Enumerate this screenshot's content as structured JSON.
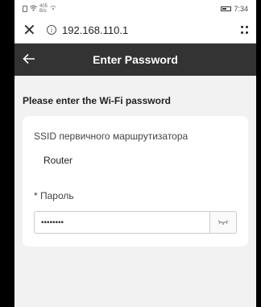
{
  "statusbar": {
    "net_speed_top": "405",
    "net_speed_bottom": "B/s",
    "time": "7:34"
  },
  "browser": {
    "url": "192.168.110.1"
  },
  "header": {
    "title": "Enter Password"
  },
  "form": {
    "prompt": "Please enter the Wi-Fi password",
    "ssid_label": "SSID первичного маршрутизатора",
    "ssid_value": "Router",
    "password_label": "* Пароль",
    "password_value": "••••••••"
  }
}
